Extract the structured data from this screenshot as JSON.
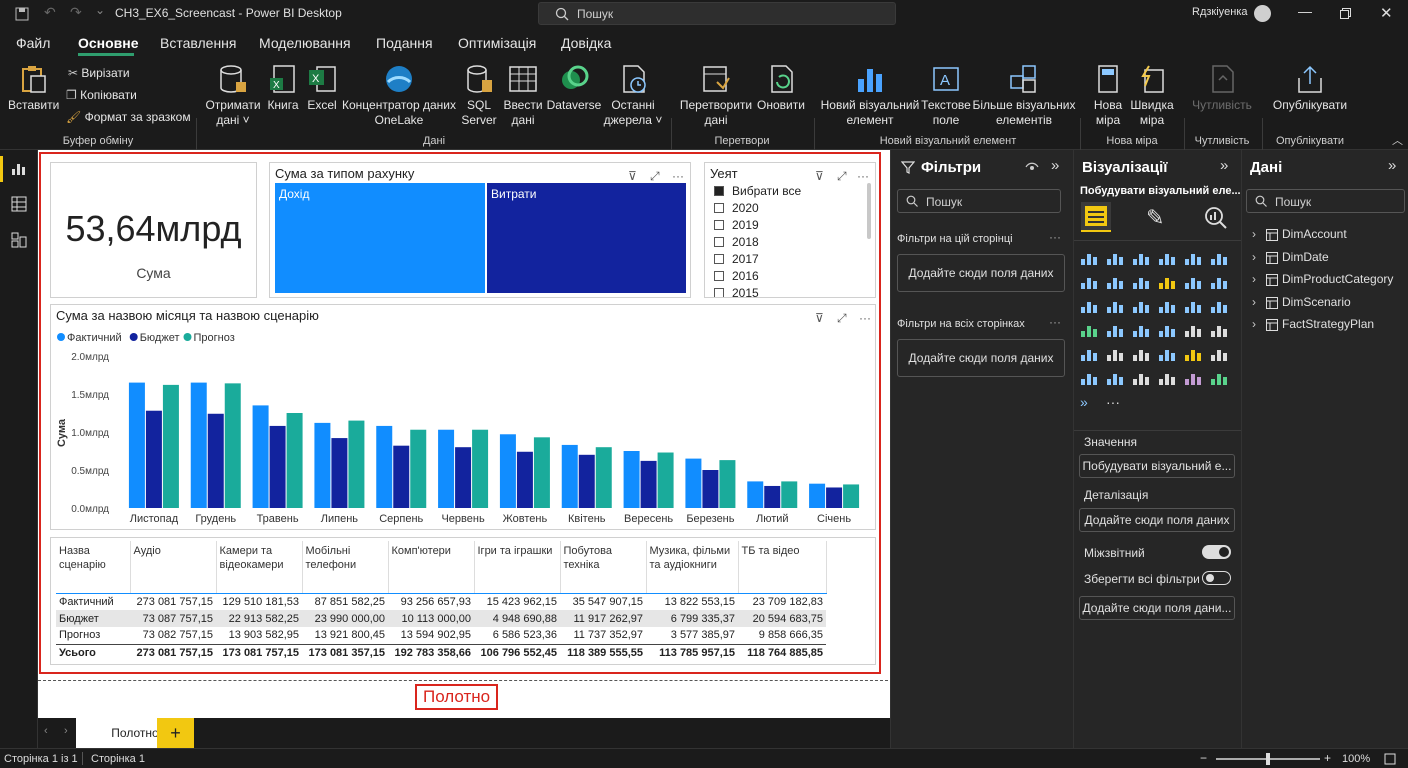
{
  "window": {
    "title": "CH3_EX6_Screencast - Power BI Desktop",
    "search_placeholder": "Пошук",
    "user": "Rдзкiyенка"
  },
  "menu": [
    "Файл",
    "Основне",
    "Вставлення",
    "Моделювання",
    "Подання",
    "Оптимізація",
    "Довідка"
  ],
  "ribbon": {
    "paste": "Вставити",
    "cut": "Вирізати",
    "copy": "Копіювати",
    "format_painter": "Формат за зразком",
    "clipboard_group": "Буфер обміну",
    "get_data_1": "Отримати",
    "get_data_2": "дані ˅",
    "workbook": "Книга",
    "excel": "Excel",
    "onelake_1": "Концентратор даних",
    "onelake_2": "OneLake",
    "sql_1": "SQL",
    "sql_2": "Server",
    "enter_1": "Ввести",
    "enter_2": "дані",
    "dataverse": "Dataverse",
    "recent_1": "Останні",
    "recent_2": "джерела ˅",
    "data_group": "Дані",
    "transform_1": "Перетворити",
    "transform_2": "дані",
    "refresh": "Оновити",
    "queries_group": "Перетвори",
    "new_visual_1": "Новий візуальний",
    "new_visual_2": "елемент",
    "textbox_1": "Текстове",
    "textbox_2": "поле",
    "more_visuals_1": "Більше візуальних",
    "more_visuals_2": "елементів",
    "insert_group": "Новий візуальний елемент",
    "new_measure_1": "Нова",
    "new_measure_2": "міра",
    "quick_measure_1": "Швидка",
    "quick_measure_2": "міра",
    "calc_group": "Нова міра",
    "sensitivity": "Чутливість",
    "sensitivity_group": "Чутливість",
    "publish": "Опублікувати",
    "share_group": "Опублікувати"
  },
  "kpi": {
    "value": "53,64млрд",
    "label": "Сума"
  },
  "treemap": {
    "title": "Сума за типом рахунку",
    "cells": [
      "Дохід",
      "Витрати"
    ],
    "colors": [
      "#118dff",
      "#12239e"
    ]
  },
  "slicer": {
    "title": "Уеят",
    "items": [
      "Вибрати все",
      "2020",
      "2019",
      "2018",
      "2017",
      "2016",
      "2015"
    ]
  },
  "chart_data": {
    "type": "bar",
    "title": "Сума за назвою місяця та назвою сценарію",
    "ylabel": "Сума",
    "xlabel": "",
    "ylim": [
      0,
      2.0
    ],
    "yticks": [
      "0.0млрд",
      "0.5млрд",
      "1.0млрд",
      "1.5млрд",
      "2.0млрд"
    ],
    "categories": [
      "Листопад",
      "Грудень",
      "Травень",
      "Липень",
      "Серпень",
      "Червень",
      "Жовтень",
      "Квітень",
      "Вересень",
      "Березень",
      "Лютий",
      "Січень"
    ],
    "series": [
      {
        "name": "Фактичний",
        "color": "#118dff",
        "values": [
          1.65,
          1.65,
          1.35,
          1.12,
          1.08,
          1.03,
          0.97,
          0.83,
          0.75,
          0.65,
          0.35,
          0.32
        ]
      },
      {
        "name": "Бюджет",
        "color": "#12239e",
        "values": [
          1.28,
          1.24,
          1.08,
          0.92,
          0.82,
          0.8,
          0.74,
          0.7,
          0.62,
          0.5,
          0.29,
          0.27
        ]
      },
      {
        "name": "Прогноз",
        "color": "#1aab9b",
        "values": [
          1.62,
          1.64,
          1.25,
          1.15,
          1.03,
          1.03,
          0.93,
          0.8,
          0.73,
          0.63,
          0.35,
          0.31
        ]
      }
    ],
    "legend": "top-left"
  },
  "matrix": {
    "header": [
      "Назва сценарію",
      "Аудіо",
      "Камери та відеокамери",
      "Мобільні телефони",
      "Комп'ютери",
      "Ігри та іграшки",
      "Побутова техніка",
      "Музика, фільми та аудіокниги",
      "ТБ та відео"
    ],
    "rows": [
      [
        "Фактичний",
        "273 081 757,15",
        "129 510 181,53",
        "87 851 582,25",
        "93 256 657,93",
        "15 423 962,15",
        "35 547 907,15",
        "13 822 553,15",
        "23 709 182,83"
      ],
      [
        "Бюджет",
        "73 087 757,15",
        "22 913 582,25",
        "23 990 000,00",
        "10 113 000,00",
        "4 948 690,88",
        "11 917 262,97",
        "6 799 335,37",
        "20 594 683,75"
      ],
      [
        "Прогноз",
        "73 082 757,15",
        "13 903 582,95",
        "13 921 800,45",
        "13 594 902,95",
        "6 586 523,36",
        "11 737 352,97",
        "3 577 385,97",
        "9 858 666,35"
      ],
      [
        "Усього",
        "273 081 757,15",
        "173 081 757,15",
        "173 081 357,15",
        "192 783 358,66",
        "106 796 552,45",
        "118 389 555,55",
        "113 785 957,15",
        "118 764 885,85"
      ]
    ]
  },
  "canvas_label": "Полотно",
  "tabs": {
    "page": "Полотно",
    "add": "+"
  },
  "status": {
    "page_of": "Сторінка 1 із 1",
    "page": "Сторінка 1",
    "zoom": "100%"
  },
  "filters": {
    "title": "Фільтри",
    "search": "Пошук",
    "this_page": "Фільтри на цій сторінці",
    "this_page_drop": "Додайте сюди поля даних",
    "all_pages": "Фільтри на всіх сторінках",
    "all_pages_drop": "Додайте сюди поля даних"
  },
  "viz": {
    "title": "Візуалізації",
    "build": "Побудувати візуальний еле...",
    "values": "Значення",
    "values_drop": "Побудувати візуальний е...",
    "drill": "Деталізація",
    "drill_drop": "Додайте сюди поля даних",
    "cross": "Міжзвітний",
    "keep": "Зберегти всі фільтри",
    "extra_drop": "Додайте сюди поля дани...",
    "more": "···"
  },
  "data_pane": {
    "title": "Дані",
    "search": "Пошук",
    "tables": [
      "DimAccount",
      "DimDate",
      "DimProductCategory",
      "DimScenario",
      "FactStrategyPlan"
    ]
  }
}
